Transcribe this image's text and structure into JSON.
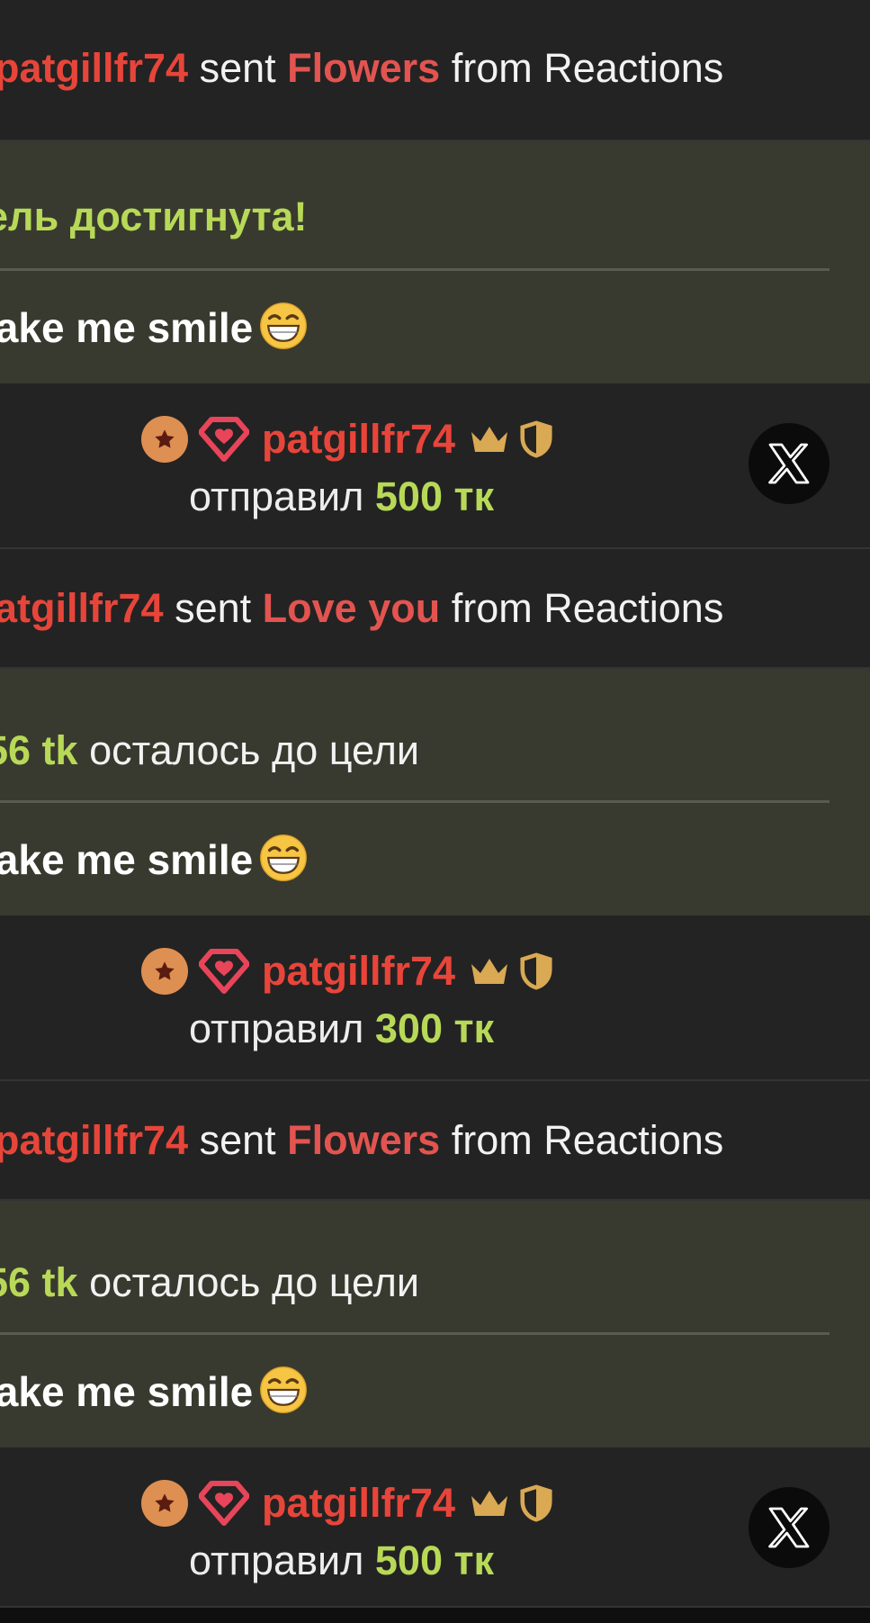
{
  "feed": {
    "reaction_1": {
      "user": "patgillfr74",
      "verb": "sent",
      "item": "Flowers",
      "suffix": "from Reactions"
    },
    "goal_1": {
      "status": "ель достигнута!",
      "message": "lake me smile"
    },
    "tip_1": {
      "user": "patgillfr74",
      "verb": "отправил",
      "amount": "500 тк",
      "share_button": "X"
    },
    "reaction_2": {
      "user": "atgillfr74",
      "verb": "sent",
      "item": "Love you",
      "suffix": "from Reactions"
    },
    "goal_2": {
      "remaining_amount": "56 tk",
      "remaining_text": "осталось до цели",
      "message": "lake me smile"
    },
    "tip_2": {
      "user": "patgillfr74",
      "verb": "отправил",
      "amount": "300 тк"
    },
    "reaction_3": {
      "user": "patgillfr74",
      "verb": "sent",
      "item": "Flowers",
      "suffix": "from Reactions"
    },
    "goal_3": {
      "remaining_amount": "56 tk",
      "remaining_text": "осталось до цели",
      "message": "lake me smile"
    },
    "tip_3": {
      "user": "patgillfr74",
      "verb": "отправил",
      "amount": "500 тк",
      "share_button": "X"
    }
  },
  "icons": {
    "badge": "star-badge-icon",
    "gem": "diamond-heart-icon",
    "crown": "crown-icon",
    "shield": "shield-icon",
    "emoji": "grinning-face-emoji",
    "share": "x-logo-icon"
  },
  "colors": {
    "background": "#232323",
    "goal_background": "#393a2f",
    "username": "#e8453a",
    "accent_green": "#b8d957",
    "badge_orange": "#de8f52",
    "gold": "#d9a953"
  }
}
